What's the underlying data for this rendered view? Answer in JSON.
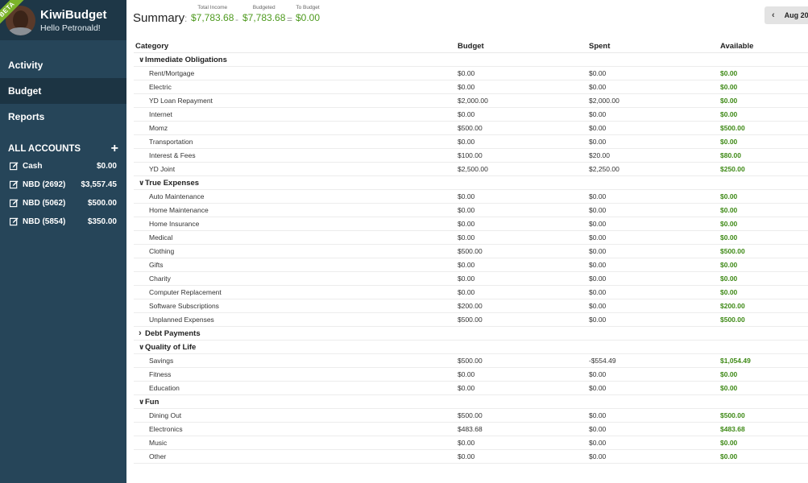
{
  "app": {
    "name": "KiwiBudget",
    "greeting": "Hello Petronald!",
    "beta": "BETA"
  },
  "nav": [
    {
      "label": "Activity",
      "active": false
    },
    {
      "label": "Budget",
      "active": true
    },
    {
      "label": "Reports",
      "active": false
    }
  ],
  "accounts": {
    "header": "ALL ACCOUNTS",
    "add_icon": "+",
    "items": [
      {
        "name": "Cash",
        "balance": "$0.00"
      },
      {
        "name": "NBD (2692)",
        "balance": "$3,557.45"
      },
      {
        "name": "NBD (5062)",
        "balance": "$500.00"
      },
      {
        "name": "NBD (5854)",
        "balance": "$350.00"
      }
    ]
  },
  "summary": {
    "title": "Summary",
    "colon": ":",
    "income_label": "Total Income",
    "income": "$7,783.68",
    "minus": "-",
    "budgeted_label": "Budgeted",
    "budgeted": "$7,783.68",
    "equals": "=",
    "to_budget_label": "To Budget",
    "to_budget": "$0.00"
  },
  "month": {
    "prev_icon": "‹",
    "label": "Aug 20"
  },
  "table": {
    "headers": {
      "category": "Category",
      "budget": "Budget",
      "spent": "Spent",
      "available": "Available"
    },
    "groups": [
      {
        "name": "Immediate Obligations",
        "expanded": true,
        "rows": [
          [
            "Rent/Mortgage",
            "$0.00",
            "$0.00",
            "$0.00"
          ],
          [
            "Electric",
            "$0.00",
            "$0.00",
            "$0.00"
          ],
          [
            "YD Loan Repayment",
            "$2,000.00",
            "$2,000.00",
            "$0.00"
          ],
          [
            "Internet",
            "$0.00",
            "$0.00",
            "$0.00"
          ],
          [
            "Momz",
            "$500.00",
            "$0.00",
            "$500.00"
          ],
          [
            "Transportation",
            "$0.00",
            "$0.00",
            "$0.00"
          ],
          [
            "Interest & Fees",
            "$100.00",
            "$20.00",
            "$80.00"
          ],
          [
            "YD Joint",
            "$2,500.00",
            "$2,250.00",
            "$250.00"
          ]
        ]
      },
      {
        "name": "True Expenses",
        "expanded": true,
        "rows": [
          [
            "Auto Maintenance",
            "$0.00",
            "$0.00",
            "$0.00"
          ],
          [
            "Home Maintenance",
            "$0.00",
            "$0.00",
            "$0.00"
          ],
          [
            "Home Insurance",
            "$0.00",
            "$0.00",
            "$0.00"
          ],
          [
            "Medical",
            "$0.00",
            "$0.00",
            "$0.00"
          ],
          [
            "Clothing",
            "$500.00",
            "$0.00",
            "$500.00"
          ],
          [
            "Gifts",
            "$0.00",
            "$0.00",
            "$0.00"
          ],
          [
            "Charity",
            "$0.00",
            "$0.00",
            "$0.00"
          ],
          [
            "Computer Replacement",
            "$0.00",
            "$0.00",
            "$0.00"
          ],
          [
            "Software Subscriptions",
            "$200.00",
            "$0.00",
            "$200.00"
          ],
          [
            "Unplanned Expenses",
            "$500.00",
            "$0.00",
            "$500.00"
          ]
        ]
      },
      {
        "name": "Debt Payments",
        "expanded": false,
        "rows": []
      },
      {
        "name": "Quality of Life",
        "expanded": true,
        "rows": [
          [
            "Savings",
            "$500.00",
            "-$554.49",
            "$1,054.49"
          ],
          [
            "Fitness",
            "$0.00",
            "$0.00",
            "$0.00"
          ],
          [
            "Education",
            "$0.00",
            "$0.00",
            "$0.00"
          ]
        ]
      },
      {
        "name": "Fun",
        "expanded": true,
        "rows": [
          [
            "Dining Out",
            "$500.00",
            "$0.00",
            "$500.00"
          ],
          [
            "Electronics",
            "$483.68",
            "$0.00",
            "$483.68"
          ],
          [
            "Music",
            "$0.00",
            "$0.00",
            "$0.00"
          ],
          [
            "Other",
            "$0.00",
            "$0.00",
            "$0.00"
          ]
        ]
      }
    ]
  }
}
